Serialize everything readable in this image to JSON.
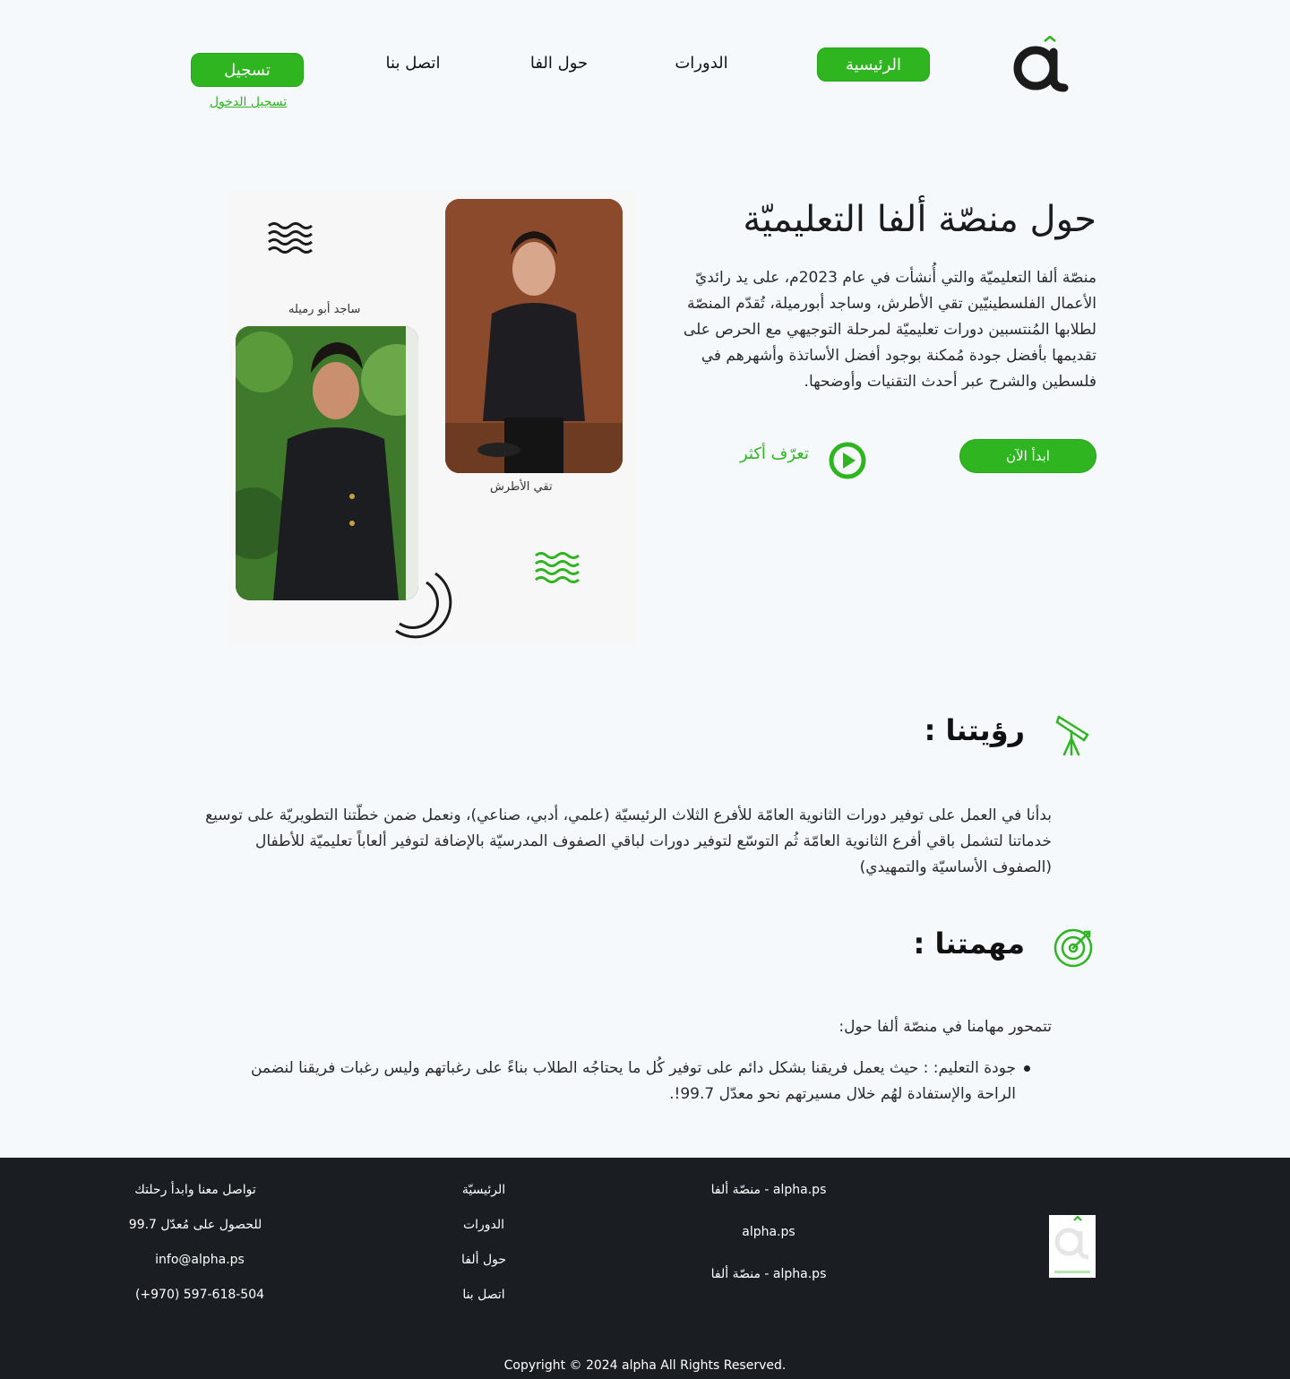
{
  "colors": {
    "accent": "#2eb520",
    "footer_bg": "#1a1d22",
    "page_bg": "#f6f9fc"
  },
  "header": {
    "logo_icon": "alpha-logo-icon",
    "nav": {
      "home": "الرئيسية",
      "courses": "الدورات",
      "about": "حول الفا",
      "contact": "اتصل بنا"
    },
    "register_label": "تسجيل",
    "login_label": "تسجيل الدخول"
  },
  "hero": {
    "title": "حول منصّة ألفا التعليميّة",
    "paragraph": "منصّة ألفا التعليميّة والتي أُنشأت في عام 2023م، على يد رائديّ الأعمال الفلسطينيّين تقي الأطرش، وساجد أبورميلة، تُقدّم المنصّة لطلابها المُنتسبين دورات تعليميّة لمرحلة التوجيهي مع الحرص على تقديمها بأفضل جودة مُمكنة بوجود أفضل الأساتذة وأشهرهم في فلسطين والشرح عبر أحدث التقنيات وأوضحها.",
    "start_label": "ابدأ الآن",
    "learn_more_label": "تعرّف أكثر",
    "play_icon": "play-circle-icon",
    "photo1_caption": "تقي الأطرش",
    "photo2_caption": "ساجد أبو رميله"
  },
  "vision": {
    "title": "رؤيتنا :",
    "icon": "telescope-icon",
    "paragraph": "بدأنا في العمل على توفير دورات الثانوية العامّة للأفرع الثلاث الرئيسيّة (علمي، أدبي، صناعي)، ونعمل ضمن خطّتنا التطويريّة على توسيع خدماتنا لتشمل باقي أفرع الثانوية العامّة ثُم التوسّع لتوفير دورات لباقي الصفوف المدرسيّة بالإضافة لتوفير ألعاباً تعليميّة للأطفال (الصفوف الأساسيّة والتمهيدي)"
  },
  "mission": {
    "title": "مهمتنا :",
    "icon": "target-icon",
    "intro": "تتمحور مهامنا في منصّة ألفا حول:",
    "items": [
      "جودة التعليم: : حيث يعمل فريقنا بشكل دائم على توفير كُل ما يحتاجُه الطلاب بناءً على رغباتهم وليس رغبات فريقنا لنضمن الراحة والإستفادة لهُم خلال مسيرتهم نحو معدّل 99.7!."
    ]
  },
  "footer": {
    "col1": [
      "منصّة ألفا - alpha.ps",
      "alpha.ps",
      "منصّة ألفا - alpha.ps"
    ],
    "col2": [
      "الرئيسيّة",
      "الدورات",
      "حول ألفا",
      "اتصل بنا"
    ],
    "col3": [
      "تواصل معنا وابدأ رحلتك",
      "للحصول على مُعدّل 99.7",
      "info@alpha.ps",
      "(+970) 597-618-504"
    ],
    "copyright": "Copyright © 2024 alpha All Rights Reserved."
  }
}
